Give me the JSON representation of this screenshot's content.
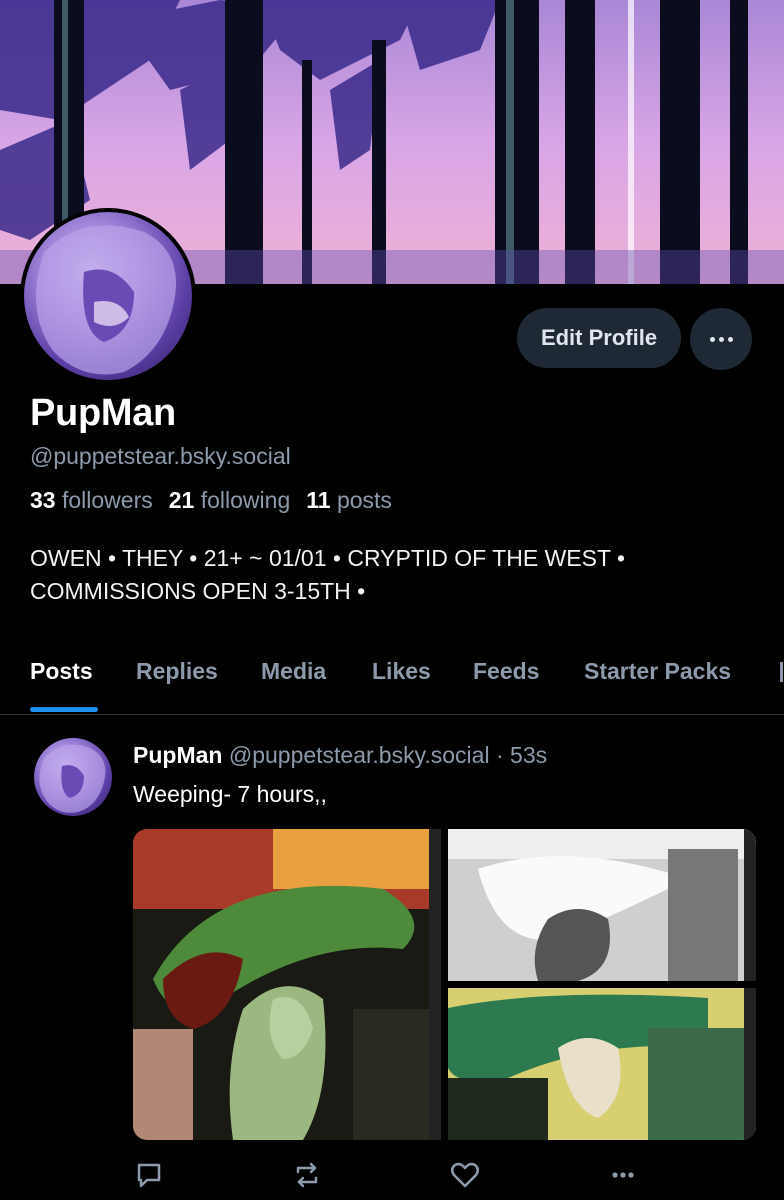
{
  "profile": {
    "display_name": "PupMan",
    "handle": "@puppetstear.bsky.social",
    "followers_count": "33",
    "followers_label": "followers",
    "following_count": "21",
    "following_label": "following",
    "posts_count": "11",
    "posts_label": "posts",
    "bio_line1": "OWEN • THEY • 21+ ~ 01/01 • CRYPTID OF THE WEST •",
    "bio_line2": "COMMISSIONS OPEN 3-15TH •",
    "edit_label": "Edit Profile",
    "more_icon": "ellipsis-icon"
  },
  "tabs": [
    {
      "label": "Posts",
      "active": true
    },
    {
      "label": "Replies",
      "active": false
    },
    {
      "label": "Media",
      "active": false
    },
    {
      "label": "Likes",
      "active": false
    },
    {
      "label": "Feeds",
      "active": false
    },
    {
      "label": "Starter Packs",
      "active": false
    }
  ],
  "post": {
    "author": "PupMan",
    "handle": "@puppetstear.bsky.social",
    "separator": "·",
    "time": "53s",
    "text": "Weeping- 7 hours,,"
  },
  "actions": [
    "reply-icon",
    "repost-icon",
    "like-icon",
    "more-icon"
  ],
  "colors": {
    "accent": "#1f8cf2",
    "muted": "#8c9aab",
    "button_bg": "#1e2935",
    "background": "#000000"
  }
}
